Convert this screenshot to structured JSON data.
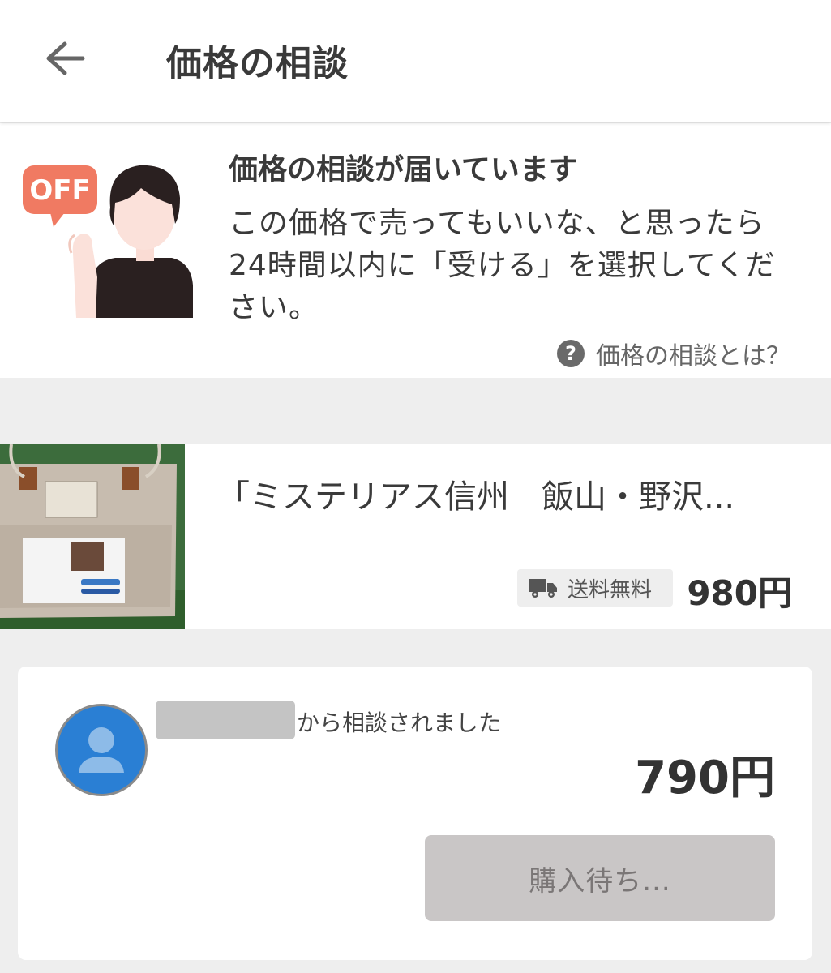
{
  "header": {
    "title": "価格の相談",
    "back_icon": "arrow-left-icon"
  },
  "notice": {
    "badge_text": "OFF",
    "title": "価格の相談が届いています",
    "body": "この価格で売ってもいいな、と思ったら24時間以内に「受ける」を選択してください。",
    "help_icon_glyph": "?",
    "help_link": "価格の相談とは？"
  },
  "product": {
    "name": "「ミステリアス信州　飯山・野沢...",
    "shipping_label": "送料無料",
    "price": "980円",
    "thumbnail_label": "ミステリアス信州 飯山・野沢温泉紀行"
  },
  "offer": {
    "from_text": "から相談されました",
    "price": "790円",
    "status_button_label": "購入待ち..."
  },
  "colors": {
    "badge": "#f07a62",
    "avatar": "#2a7fd4",
    "background": "#eeeeee"
  }
}
